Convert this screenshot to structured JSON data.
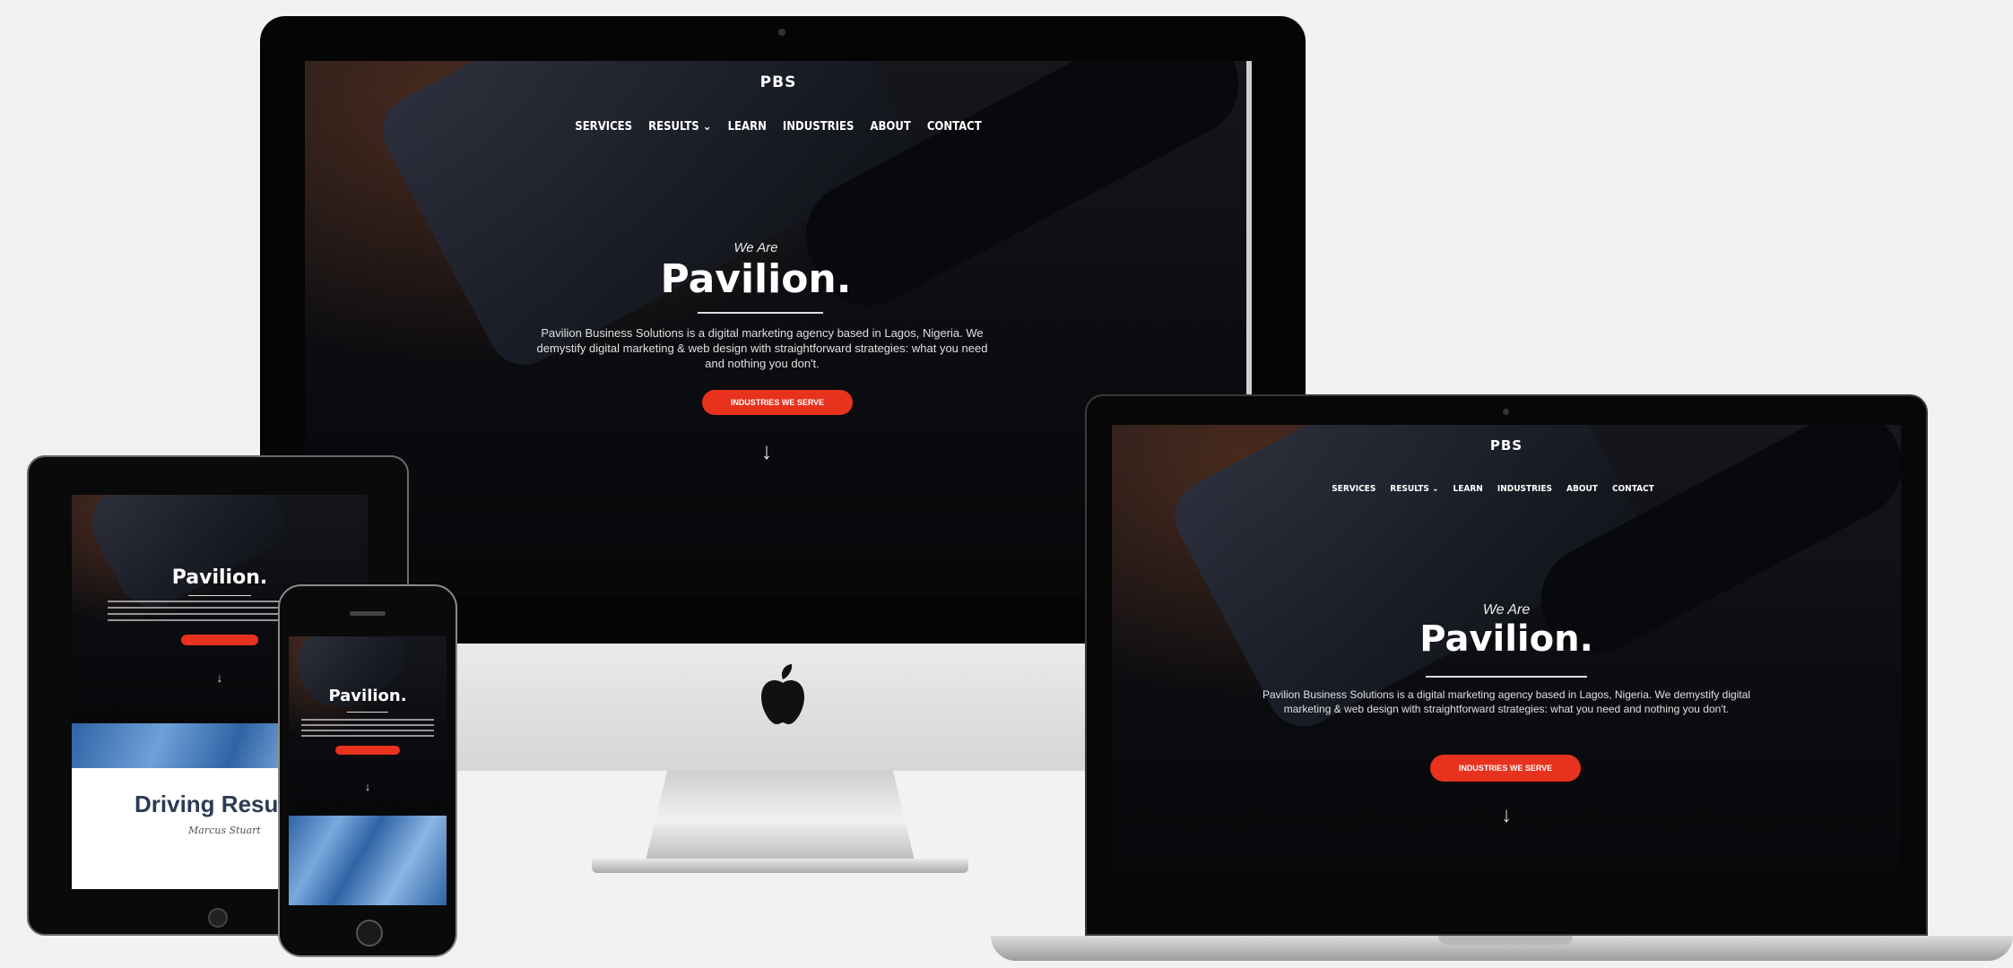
{
  "site": {
    "logo": "PBS",
    "nav": [
      "SERVICES",
      "RESULTS",
      "LEARN",
      "INDUSTRIES",
      "ABOUT",
      "CONTACT"
    ],
    "nav_dropdown_icon": "chevron-down-icon",
    "tagline": "We Are",
    "title": "Pavilion.",
    "description": "Pavilion Business Solutions is a digital marketing agency based in Lagos, Nigeria. We demystify digital marketing & web design with straightforward strategies: what you need and nothing you don't.",
    "cta": "INDUSTRIES WE SERVE",
    "arrow": "↓"
  },
  "tablet": {
    "title": "Pavilion.",
    "section_heading": "Driving Resu",
    "signature": "Marcus Stuart"
  },
  "phone": {
    "title": "Pavilion.",
    "arrow": "↓"
  },
  "colors": {
    "background": "#f2f2f2",
    "accent": "#e8321e",
    "screen": "#0c0d11",
    "blue_strip": "#3f78b8"
  }
}
